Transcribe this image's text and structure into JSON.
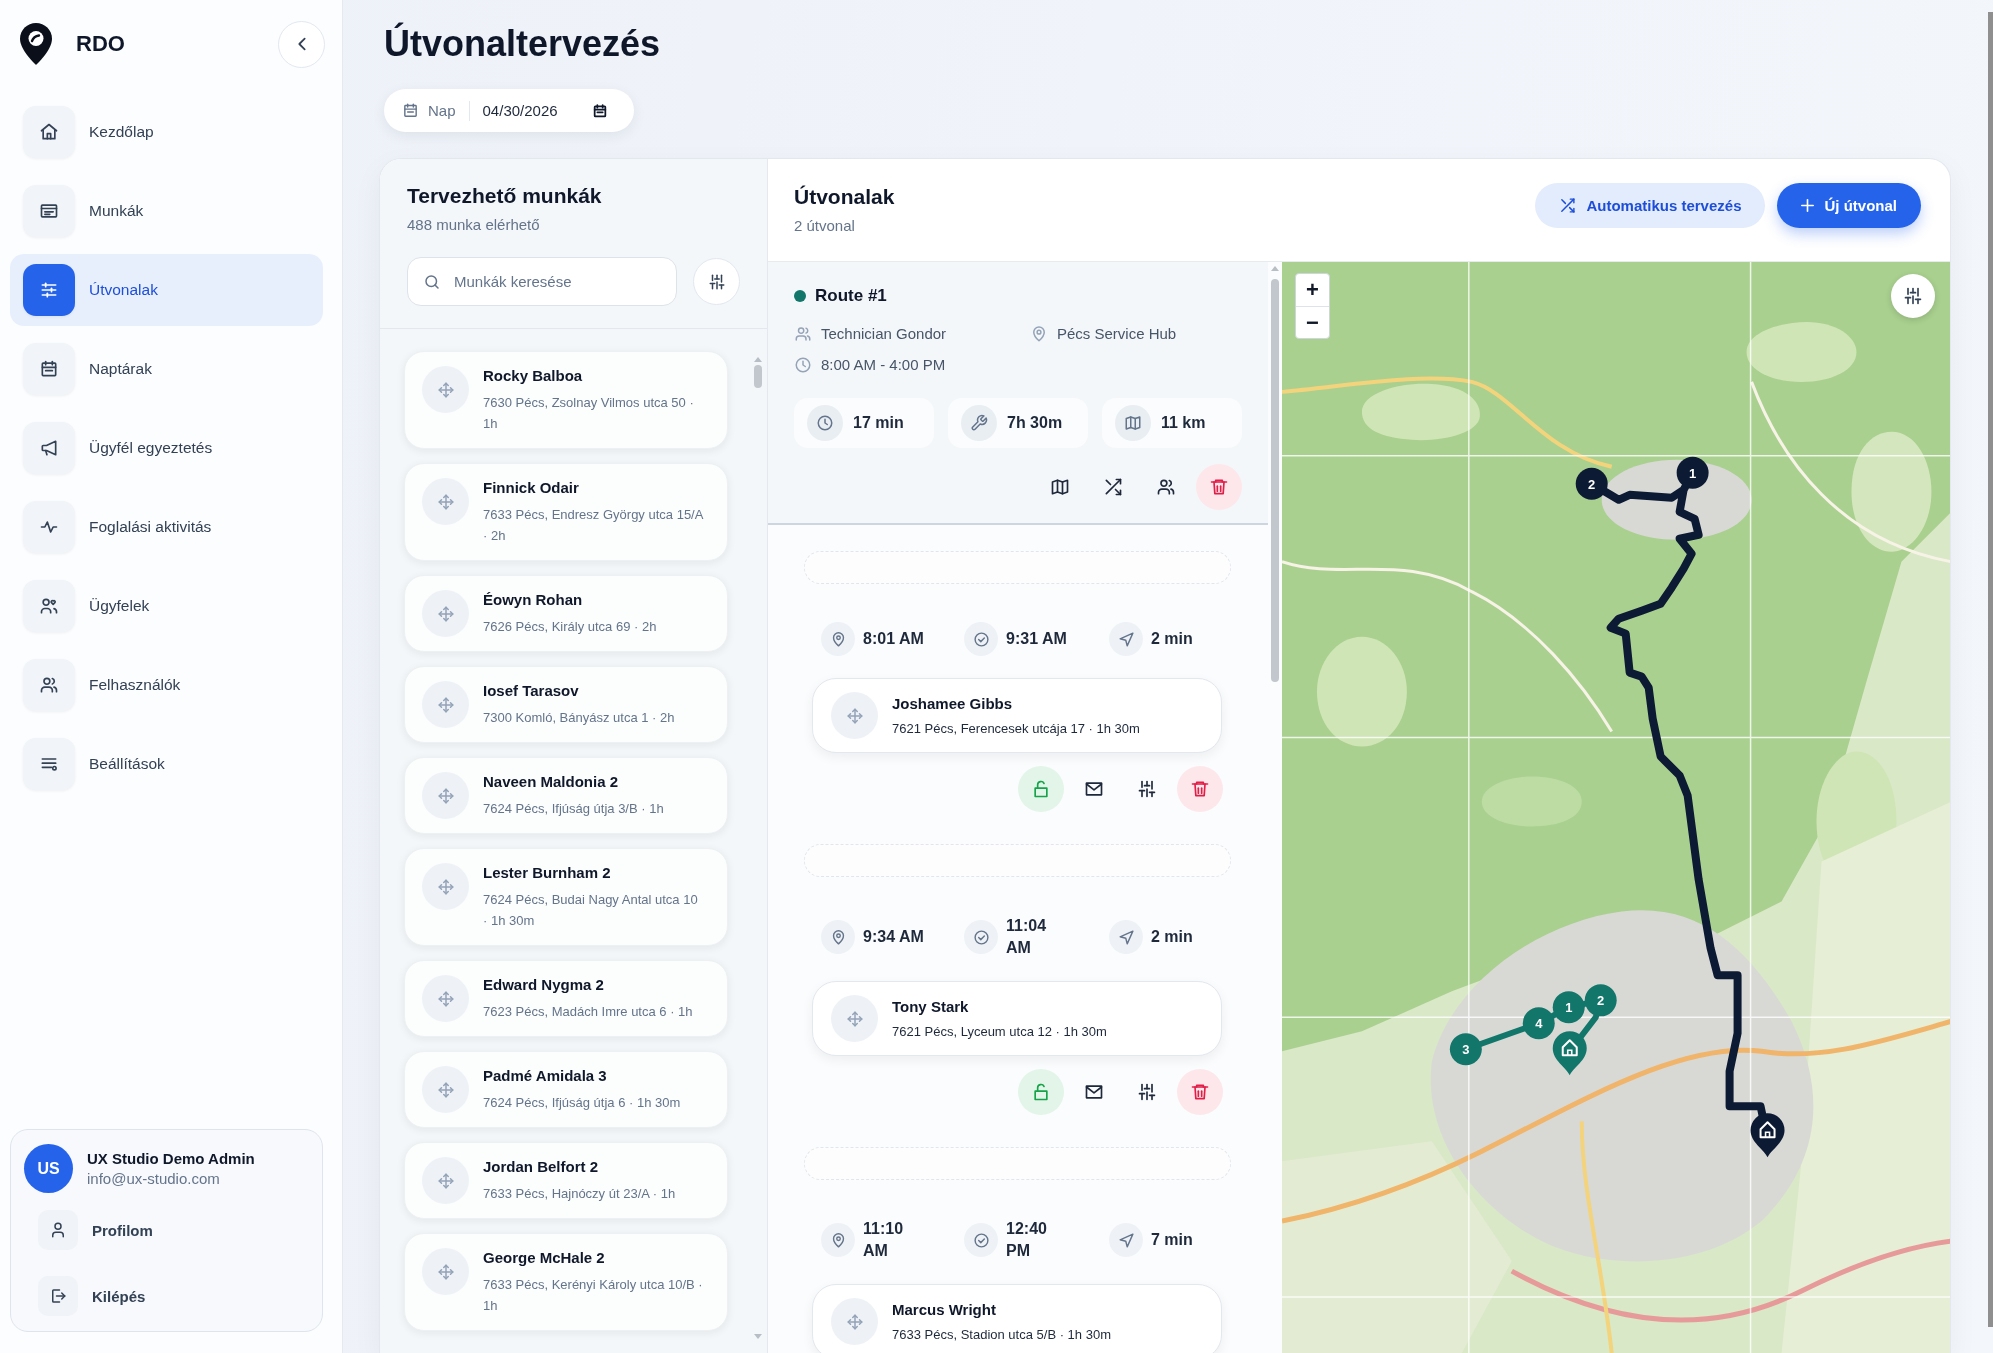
{
  "sidebar": {
    "brand": "RDO",
    "nav": [
      {
        "label": "Kezdőlap",
        "selected": false
      },
      {
        "label": "Munkák",
        "selected": false
      },
      {
        "label": "Útvonalak",
        "selected": true
      },
      {
        "label": "Naptárak",
        "selected": false
      },
      {
        "label": "Ügyfél egyeztetés",
        "selected": false
      },
      {
        "label": "Foglalási aktivitás",
        "selected": false
      },
      {
        "label": "Ügyfelek",
        "selected": false
      },
      {
        "label": "Felhasználók",
        "selected": false
      },
      {
        "label": "Beállítások",
        "selected": false
      }
    ],
    "user": {
      "initials": "US",
      "name": "UX Studio Demo Admin",
      "email": "info@ux-studio.com"
    },
    "user_menu": [
      {
        "label": "Profilom"
      },
      {
        "label": "Kilépés"
      }
    ]
  },
  "header": {
    "title": "Útvonaltervezés",
    "date_filter": {
      "mode": "Nap",
      "value": "04/30/2026"
    }
  },
  "jobs_panel": {
    "title": "Tervezhető munkák",
    "subtitle": "488 munka elérhető",
    "search": {
      "placeholder": "Munkák keresése"
    },
    "jobs": [
      {
        "name": "Rocky Balboa",
        "details": "7630 Pécs, Zsolnay Vilmos utca 50 · 1h"
      },
      {
        "name": "Finnick Odair",
        "details": "7633 Pécs, Endresz György utca 15/A · 2h"
      },
      {
        "name": "Éowyn Rohan",
        "details": "7626 Pécs, Király utca 69 · 2h"
      },
      {
        "name": "Iosef Tarasov",
        "details": "7300 Komló, Bányász utca 1 · 2h"
      },
      {
        "name": "Naveen Maldonia 2",
        "details": "7624 Pécs, Ifjúság útja 3/B · 1h"
      },
      {
        "name": "Lester Burnham 2",
        "details": "7624 Pécs, Budai Nagy Antal utca 10 · 1h 30m"
      },
      {
        "name": "Edward Nygma 2",
        "details": "7623 Pécs, Madách Imre utca 6 · 1h"
      },
      {
        "name": "Padmé Amidala 3",
        "details": "7624 Pécs, Ifjúság útja 6 · 1h 30m"
      },
      {
        "name": "Jordan Belfort 2",
        "details": "7633 Pécs, Hajnóczy út 23/A · 1h"
      },
      {
        "name": "George McHale 2",
        "details": "7633 Pécs, Kerényi Károly utca 10/B · 1h"
      }
    ]
  },
  "routes_panel": {
    "title": "Útvonalak",
    "subtitle": "2 útvonal",
    "buttons": [
      {
        "label": "Automatikus tervezés",
        "kind": "secondary"
      },
      {
        "label": "Új útvonal",
        "kind": "primary"
      }
    ],
    "routes": [
      {
        "name": "Route #1",
        "color": "#12766b",
        "technician": "Technician Gondor",
        "depot": "Pécs Service Hub",
        "hours": "8:00 AM - 4:00 PM",
        "stats": [
          "17 min",
          "7h 30m",
          "11 km"
        ],
        "stops": [
          {
            "start": "8:01 AM",
            "end": "9:31 AM",
            "travel": "2 min",
            "name": "Joshamee Gibbs",
            "details": "7621 Pécs, Ferencesek utcája 17 · 1h 30m",
            "locked": false
          },
          {
            "start": "9:34 AM",
            "end": "11:04 AM",
            "travel": "2 min",
            "name": "Tony Stark",
            "details": "7621 Pécs, Lyceum utca 12 · 1h 30m",
            "locked": false
          },
          {
            "start": "11:10 AM",
            "end": "12:40 PM",
            "travel": "7 min",
            "name": "Marcus Wright",
            "details": "7633 Pécs, Stadion utca 5/B · 1h 30m"
          }
        ]
      }
    ]
  },
  "map": {
    "zoom_controls": [
      "+",
      "−"
    ],
    "route_lines": [
      {
        "color": "#0c1a33"
      },
      {
        "color": "#12766b"
      }
    ],
    "markers": [
      {
        "kind": "stop",
        "label": "1",
        "color": "#0c1a33"
      },
      {
        "kind": "stop",
        "label": "2",
        "color": "#0c1a33"
      },
      {
        "kind": "depot",
        "color": "#0c1a33"
      },
      {
        "kind": "stop",
        "label": "1",
        "color": "#12766b"
      },
      {
        "kind": "stop",
        "label": "2",
        "color": "#12766b"
      },
      {
        "kind": "stop",
        "label": "3",
        "color": "#12766b"
      },
      {
        "kind": "stop",
        "label": "4",
        "color": "#12766b"
      },
      {
        "kind": "depot",
        "color": "#12766b"
      }
    ]
  }
}
